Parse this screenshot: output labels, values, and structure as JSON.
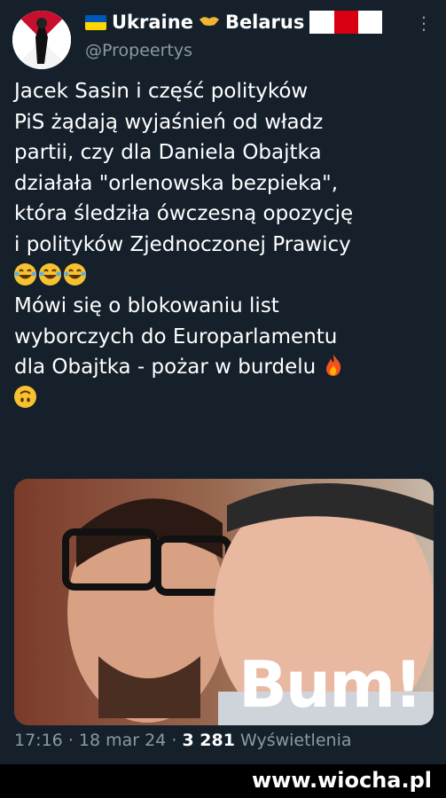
{
  "header": {
    "display_name_a": "Ukraine",
    "display_name_b": "Belarus",
    "handle": "@Propeertys",
    "more_icon": "⋮"
  },
  "tweet": {
    "lines": [
      "Jacek Sasin i część polityków",
      "PiS żądają wyjaśnień od władz",
      "partii, czy dla Daniela Obajtka",
      "działała \"orlenowska bezpieka\",",
      "która śledziła ówczesną opozycję",
      "i polityków Zjednoczonej Prawicy",
      "Mówi się o blokowaniu list",
      "wyborczych do Europarlamentu",
      "dla Obajtka - pożar w burdelu"
    ],
    "emojis": [
      "laughing-tears-emoji",
      "laughing-tears-emoji",
      "laughing-tears-emoji",
      "fire-emoji",
      "upside-down-face-emoji"
    ]
  },
  "media": {
    "overlay_text": "Bum!"
  },
  "meta": {
    "time": "17:16",
    "date": "18 mar 24",
    "views_count": "3 281",
    "views_label": "Wyświetlenia"
  },
  "watermark": {
    "text": "www.wiocha.pl"
  },
  "colors": {
    "background": "#15202b",
    "secondary_text": "#8b98a5"
  }
}
